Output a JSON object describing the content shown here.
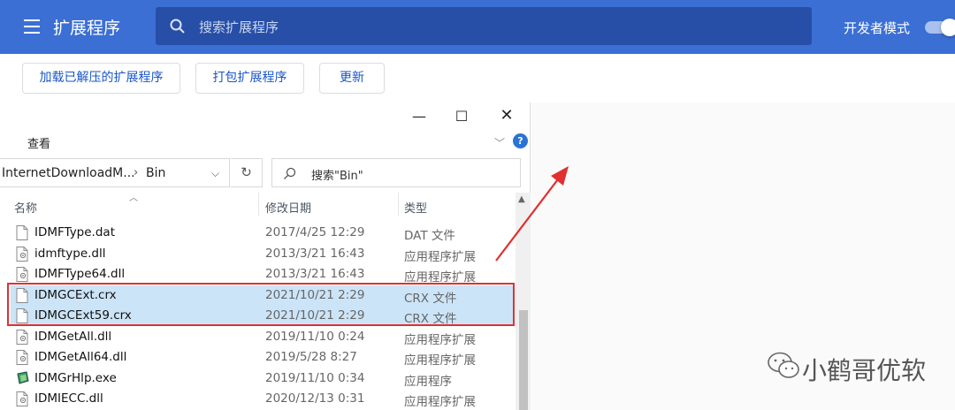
{
  "header": {
    "title": "扩展程序",
    "search_placeholder": "搜索扩展程序",
    "dev_mode_label": "开发者模式",
    "dev_mode_on": true
  },
  "toolbar": {
    "load_unpacked": "加载已解压的扩展程序",
    "pack_extension": "打包扩展程序",
    "update": "更新"
  },
  "explorer": {
    "ribbon_view": "查看",
    "path_parent": "InternetDownloadM...",
    "path_sep": "›",
    "path_current": "Bin",
    "search_placeholder": "搜索\"Bin\"",
    "columns": {
      "name": "名称",
      "modified": "修改日期",
      "type": "类型"
    },
    "files": [
      {
        "name": "IDMFType.dat",
        "date": "2017/4/25 12:29",
        "type": "DAT 文件",
        "icon": "file-icon",
        "selected": false
      },
      {
        "name": "idmftype.dll",
        "date": "2013/3/21 16:43",
        "type": "应用程序扩展",
        "icon": "dll-icon",
        "selected": false
      },
      {
        "name": "IDMFType64.dll",
        "date": "2013/3/21 16:43",
        "type": "应用程序扩展",
        "icon": "dll-icon",
        "selected": false
      },
      {
        "name": "IDMGCExt.crx",
        "date": "2021/10/21 2:29",
        "type": "CRX 文件",
        "icon": "file-icon",
        "selected": true
      },
      {
        "name": "IDMGCExt59.crx",
        "date": "2021/10/21 2:29",
        "type": "CRX 文件",
        "icon": "file-icon",
        "selected": true
      },
      {
        "name": "IDMGetAll.dll",
        "date": "2019/11/10 0:24",
        "type": "应用程序扩展",
        "icon": "dll-icon",
        "selected": false
      },
      {
        "name": "IDMGetAll64.dll",
        "date": "2019/5/28 8:27",
        "type": "应用程序扩展",
        "icon": "dll-icon",
        "selected": false
      },
      {
        "name": "IDMGrHlp.exe",
        "date": "2019/11/10 0:34",
        "type": "应用程序",
        "icon": "exe-icon",
        "selected": false
      },
      {
        "name": "IDMIECC.dll",
        "date": "2020/12/13 0:31",
        "type": "应用程序扩展",
        "icon": "dll-icon",
        "selected": false
      }
    ]
  },
  "watermark": "小鹤哥优软",
  "colors": {
    "header_bg": "#3b6fd4",
    "accent": "#1a56c8",
    "selection": "#cce4f7",
    "annotation_red": "#e03030"
  }
}
